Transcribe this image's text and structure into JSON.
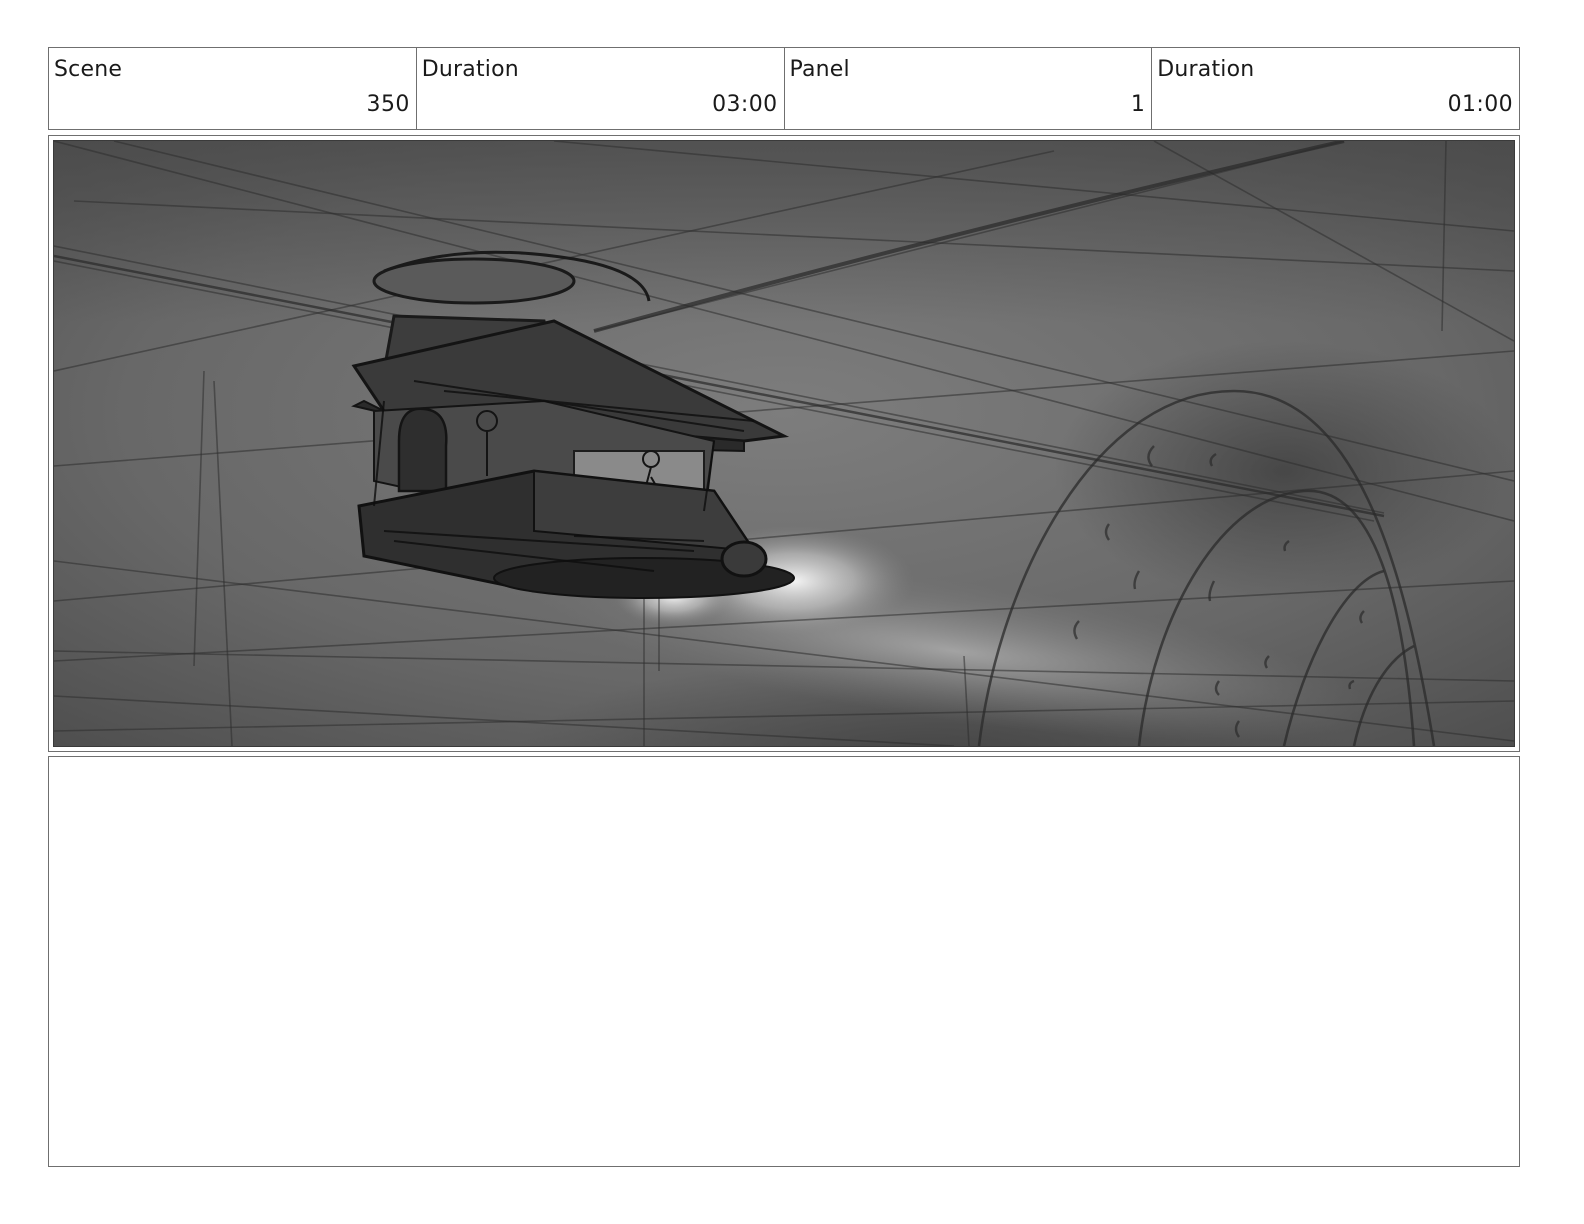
{
  "header": {
    "scene_label": "Scene",
    "scene_value": "350",
    "scene_duration_label": "Duration",
    "scene_duration_value": "03:00",
    "panel_label": "Panel",
    "panel_value": "1",
    "panel_duration_label": "Duration",
    "panel_duration_value": "01:00"
  },
  "notes": {
    "text": ""
  }
}
